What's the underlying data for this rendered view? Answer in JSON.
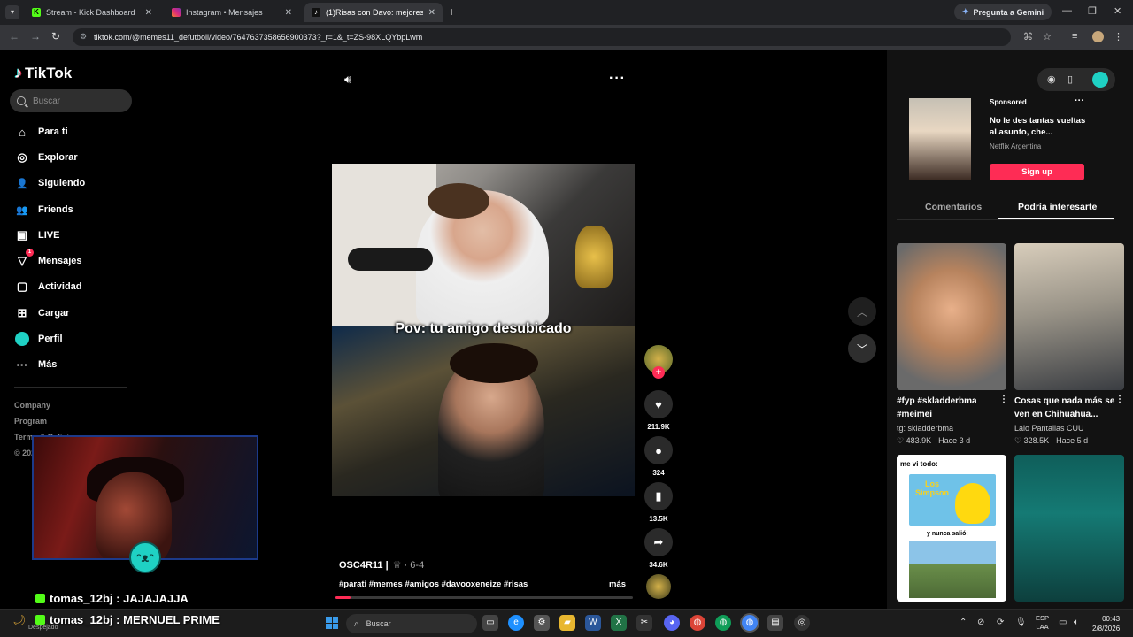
{
  "browser": {
    "tabs": [
      {
        "title": "Stream - Kick Dashboard",
        "favicon_color": "#53fc18",
        "favicon_letter": "K"
      },
      {
        "title": "Instagram • Mensajes",
        "favicon_color": "#e1306c",
        "favicon_letter": "◎"
      },
      {
        "title": "(1)Risas con Davo: mejores mem",
        "favicon_color": "#111111",
        "favicon_letter": "♪"
      }
    ],
    "url": "tiktok.com/@memes11_defutboll/video/7647637358656900373?_r=1&_t=ZS-98XLQYbpLwm",
    "gemini_label": "Pregunta a Gemini"
  },
  "sidebar": {
    "logo": "TikTok",
    "search_placeholder": "Buscar",
    "items": [
      {
        "label": "Para ti",
        "icon": "⌂"
      },
      {
        "label": "Explorar",
        "icon": "◎"
      },
      {
        "label": "Siguiendo",
        "icon": "👤"
      },
      {
        "label": "Friends",
        "icon": "👥"
      },
      {
        "label": "LIVE",
        "icon": "▣"
      },
      {
        "label": "Mensajes",
        "icon": "▽",
        "badge": "1"
      },
      {
        "label": "Actividad",
        "icon": "▢"
      },
      {
        "label": "Cargar",
        "icon": "⊞"
      },
      {
        "label": "Perfil",
        "icon": ""
      },
      {
        "label": "Más",
        "icon": "···"
      }
    ],
    "footer": [
      "Company",
      "Program",
      "Terms & Policies",
      "© 2026 TikTok"
    ]
  },
  "stream_overlay": {
    "chat": [
      {
        "user": "tomas_12bj",
        "message": "JAJAJAJJA"
      },
      {
        "user": "tomas_12bj",
        "message": "MERNUEL PRIME"
      }
    ]
  },
  "video": {
    "caption": "Pov: tu amigo desubicado",
    "author": "OSC4R11 |",
    "author_meta": "♕ · 6-4",
    "hashtags": "#parati #memes #amigos #davooxeneize #risas",
    "more_label": "más",
    "progress": 0.05,
    "likes": "211.9K",
    "comments": "324",
    "saves": "13.5K",
    "shares": "34.6K"
  },
  "right_panel": {
    "ad": {
      "sponsored": "Sponsored",
      "title": "No le des tantas vueltas al asunto, che...",
      "brand": "Netflix Argentina",
      "cta": "Sign up"
    },
    "tabs": [
      "Comentarios",
      "Podría interesarte"
    ],
    "cards": [
      {
        "title": "#fyp #skladderbma #meimei",
        "author": "tg: skladderbma",
        "stats": "♡ 483.9K · Hace 3 d"
      },
      {
        "title": "Cosas que nada más se ven en Chihuahua...",
        "author": "Lalo Pantallas CUU",
        "stats": "♡ 328.5K · Hace 5 d"
      }
    ],
    "card3_text_top": "me vi todo:",
    "card3_text_logo": "Los Simpson",
    "card3_text_mid": "y nunca salió:"
  },
  "taskbar": {
    "weather": "Despejado",
    "search": "Buscar",
    "lang": "ESP",
    "lang2": "LAA",
    "time": "00:43",
    "date": "2/8/2026"
  }
}
